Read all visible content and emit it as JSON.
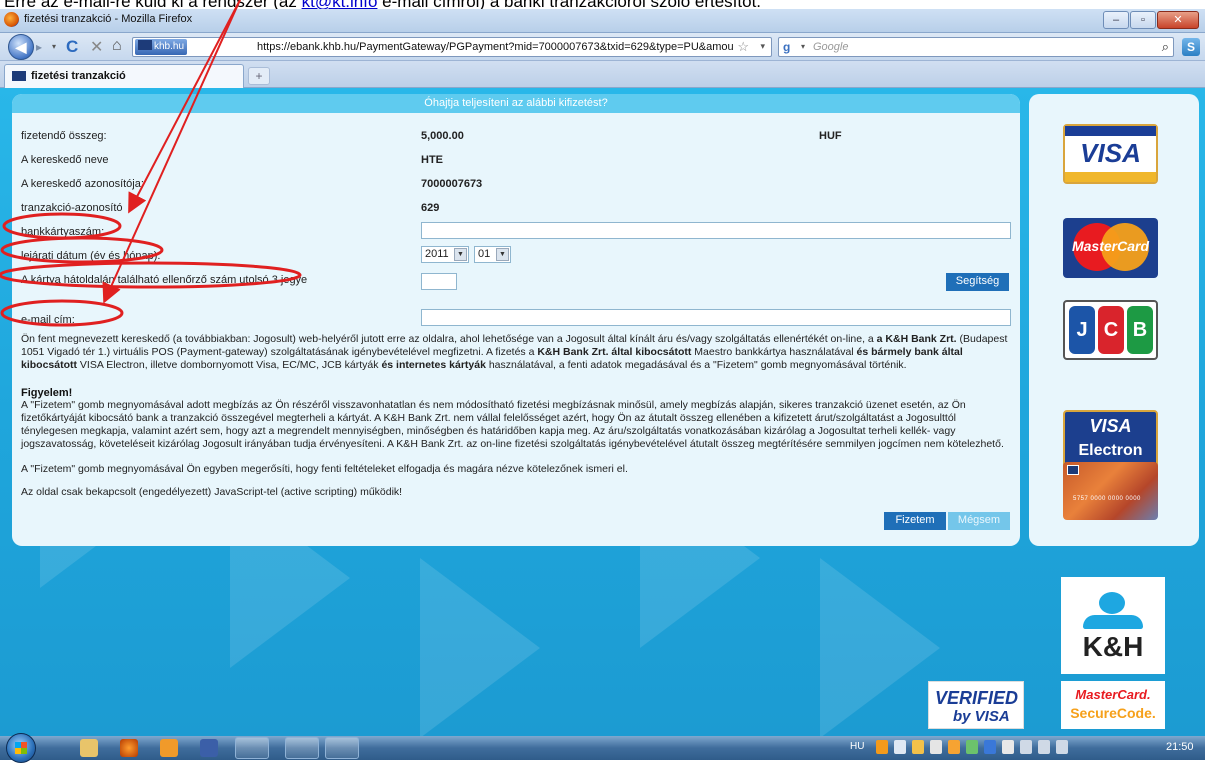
{
  "caption": {
    "before": "Erre az e-mail-re küld ki a rendszer (az ",
    "link": "kt@kt.info",
    "after": " e-mail címről) a banki tranzakcióról szóló értesítőt."
  },
  "window": {
    "title": "fizetési tranzakció - Mozilla Firefox",
    "btn_minimize": "–",
    "btn_maximize": "▫",
    "btn_close": "✕"
  },
  "toolbar": {
    "back": "◀",
    "forward": "▸",
    "dropdown": "▾",
    "reload": "C",
    "stop": "✕",
    "home": "⌂",
    "site_identity": "khb.hu",
    "url": "https://ebank.khb.hu/PaymentGateway/PGPayment?mid=7000007673&txid=629&type=PU&amou",
    "bookmark_star": "☆",
    "url_dropdown": "▾",
    "search_placeholder": "Google",
    "search_engine": "g",
    "search_icon": "⌕",
    "extra": "S"
  },
  "tabs": [
    {
      "label": "fizetési tranzakció"
    }
  ],
  "new_tab": "+",
  "form": {
    "heading": "Óhajtja teljesíteni az alábbi kifizetést?",
    "amount_label": "fizetendő összeg:",
    "amount_value": "5,000.00",
    "currency": "HUF",
    "merchant_name_label": "A kereskedő neve",
    "merchant_name_value": "HTE",
    "merchant_id_label": "A kereskedő azonosítója:",
    "merchant_id_value": "7000007673",
    "txn_id_label": "tranzakció-azonosító",
    "txn_id_value": "629",
    "card_number_label": "bankkártyaszám:",
    "card_number_value": "",
    "expiry_label": "lejárati dátum (év és hónap):",
    "expiry_year": "2011",
    "expiry_month": "01",
    "cvc_label": "A kártya hátoldalán található ellenőrző szám utolsó 3 jegye",
    "cvc_value": "",
    "help_button": "Segítség",
    "email_label": "e-mail cím:",
    "email_value": ""
  },
  "body_text": {
    "p1_a": "Ön fent megnevezett kereskedő (a továbbiakban: Jogosult) web-helyéről jutott erre az oldalra, ahol lehetősége van a Jogosult által kínált áru és/vagy szolgáltatás ellenértékét on-line, a ",
    "p1_b": "a K&H Bank Zrt.",
    "p1_c": " (Budapest 1051 Vigadó tér 1.) virtuális POS (Payment-gateway) szolgáltatásának igénybevételével megfizetni. A fizetés a ",
    "p1_d": "K&H Bank Zrt. által kibocsátott",
    "p1_e": " Maestro bankkártya használatával ",
    "p1_f": "és bármely bank által kibocsátott",
    "p1_g": " VISA Electron, illetve dombornyomott Visa, EC/MC, JCB kártyák ",
    "p1_h": "és internetes kártyák",
    "p1_i": " használatával, a fenti adatok megadásával és a \"Fizetem\" gomb megnyomásával történik.",
    "warning_title": "Figyelem!",
    "warning_text": "A \"Fizetem\" gomb megnyomásával adott megbízás az Ön részéről visszavonhatatlan és nem módosítható fizetési megbízásnak minősül, amely megbízás alapján, sikeres tranzakció üzenet esetén, az Ön fizetőkártyáját kibocsátó bank a tranzakció összegével megterheli a kártyát. A K&H Bank Zrt. nem vállal felelősséget azért, hogy Ön az átutalt összeg ellenében a kifizetett árut/szolgáltatást a Jogosulttól ténylegesen megkapja, valamint azért sem, hogy azt a megrendelt mennyiségben, minőségben és határidőben kapja meg. Az áru/szolgáltatás vonatkozásában kizárólag a Jogosultat terheli kellék- vagy jogszavatosság, követeléseit kizárólag Jogosult irányában tudja érvényesíteni. A K&H Bank Zrt. az on-line fizetési szolgáltatás igénybevételével átutalt összeg megtérítésére semmilyen jogcímen nem kötelezhető.",
    "confirm_text": "A \"Fizetem\" gomb megnyomásával Ön egyben megerősíti, hogy fenti feltételeket elfogadja és magára nézve kötelezőnek ismeri el.",
    "js_note": "Az oldal csak bekapcsolt (engedélyezett) JavaScript-tel (active scripting) működik!"
  },
  "buttons": {
    "pay": "Fizetem",
    "cancel": "Mégsem"
  },
  "cards": {
    "visa": "VISA",
    "mastercard": "MasterCard",
    "jcb_j": "J",
    "jcb_c": "C",
    "jcb_b": "B",
    "visa_electron_1": "VISA",
    "visa_electron_2": "Electron",
    "kh_card_number": "5757 0000 0000 0000"
  },
  "logos": {
    "kh": "K&H",
    "verified_1": "VERIFIED",
    "verified_2": "by VISA",
    "mc_secure_1": "MasterCard.",
    "mc_secure_2": "SecureCode."
  },
  "taskbar": {
    "lang": "HU",
    "clock": "21:50"
  },
  "colors": {
    "page_bg": "#1fa6dc",
    "panel_bg": "#e8f6fc",
    "panel_header": "#5fcbef",
    "button_blue": "#1f6fb8",
    "annotation_red": "#e02020"
  }
}
